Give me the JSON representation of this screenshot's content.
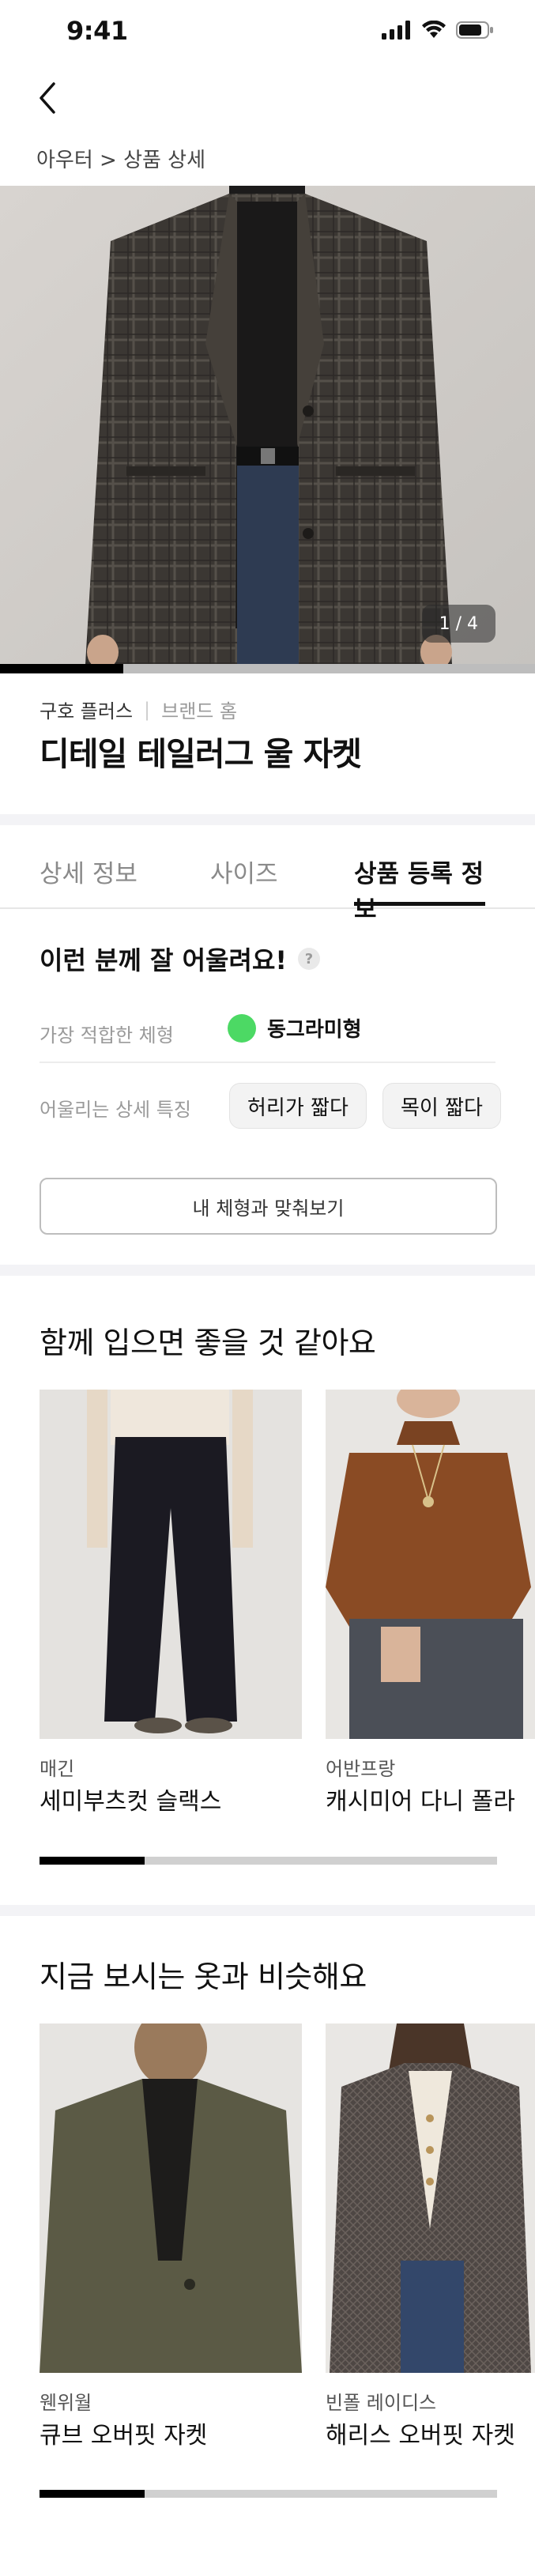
{
  "status_bar": {
    "time": "9:41"
  },
  "breadcrumb": "아우터 > 상품 상세",
  "gallery": {
    "indicator": "1 / 4",
    "progress": 0.23
  },
  "product": {
    "brand": "구호 플러스",
    "brand_home": "브랜드 홈",
    "title": "디테일 테일러그 울 자켓"
  },
  "tabs": [
    {
      "label": "상세 정보",
      "active": false
    },
    {
      "label": "사이즈",
      "active": false
    },
    {
      "label": "상품 등록 정보",
      "active": true
    }
  ],
  "fit": {
    "title": "이런 분께 잘 어울려요!",
    "help_icon": "?",
    "body_type_label": "가장 적합한 체형",
    "body_type_value": "동그라미형",
    "body_type_color": "#4cd964",
    "features_label": "어울리는 상세 특징",
    "features": [
      "허리가 짧다",
      "목이 짧다"
    ],
    "compare_button": "내 체형과 맞춰보기"
  },
  "together": {
    "title": "함께 입으면 좋을 것 같아요",
    "items": [
      {
        "brand": "매긴",
        "name": "세미부츠컷 슬랙스"
      },
      {
        "brand": "어반프랑",
        "name": "캐시미어 다니 폴라"
      }
    ],
    "scroll_progress": 0.23
  },
  "similar": {
    "title": "지금 보시는 옷과 비슷해요",
    "items": [
      {
        "brand": "웬위월",
        "name": "큐브 오버핏 자켓"
      },
      {
        "brand": "빈폴 레이디스",
        "name": "해리스 오버핏 자켓"
      }
    ],
    "scroll_progress": 0.23
  }
}
